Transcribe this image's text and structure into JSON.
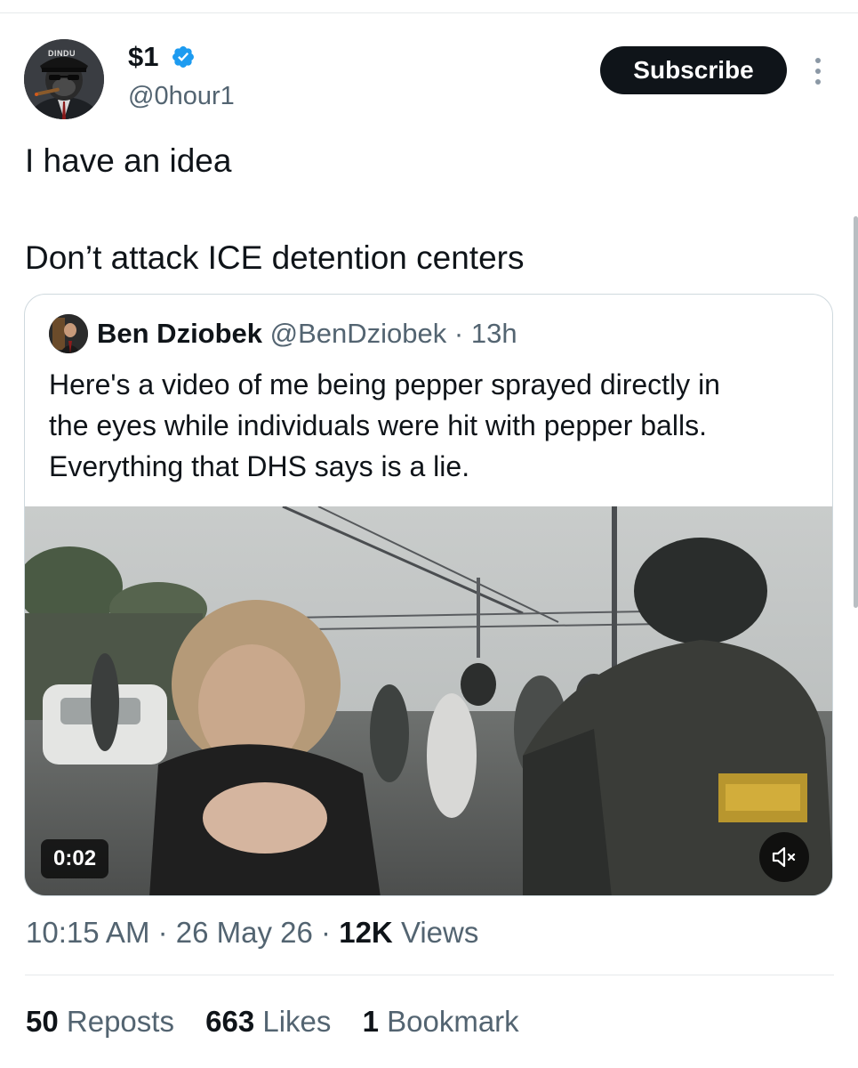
{
  "author": {
    "display_name": "$1",
    "handle": "@0hour1",
    "avatar_text": "DINDU",
    "verified_icon": "verified-badge-icon",
    "subscribe_label": "Subscribe",
    "accent": "#1d9bf0"
  },
  "tweet": {
    "lines": [
      "I have an idea",
      "Don’t attack ICE detention centers"
    ]
  },
  "quote": {
    "name": "Ben Dziobek",
    "handle": "@BenDziobek",
    "separator": "·",
    "time": "13h",
    "text_lines": [
      "Here's a video of me being pepper sprayed directly in",
      "the eyes while individuals were hit with pepper balls.",
      "Everything that DHS says is a lie."
    ],
    "video": {
      "duration": "0:02",
      "mute_icon": "speaker-muted-icon"
    }
  },
  "meta": {
    "time": "10:15 AM",
    "separator": "·",
    "date": "26 May 26",
    "views_count": "12K",
    "views_label": "Views"
  },
  "stats": {
    "reposts_count": "50",
    "reposts_label": "Reposts",
    "likes_count": "663",
    "likes_label": "Likes",
    "bookmarks_count": "1",
    "bookmarks_label": "Bookmark"
  },
  "colors": {
    "text": "#0f1419",
    "secondary_text": "#536471",
    "border": "#cfd9de",
    "button_bg": "#0f1419"
  }
}
